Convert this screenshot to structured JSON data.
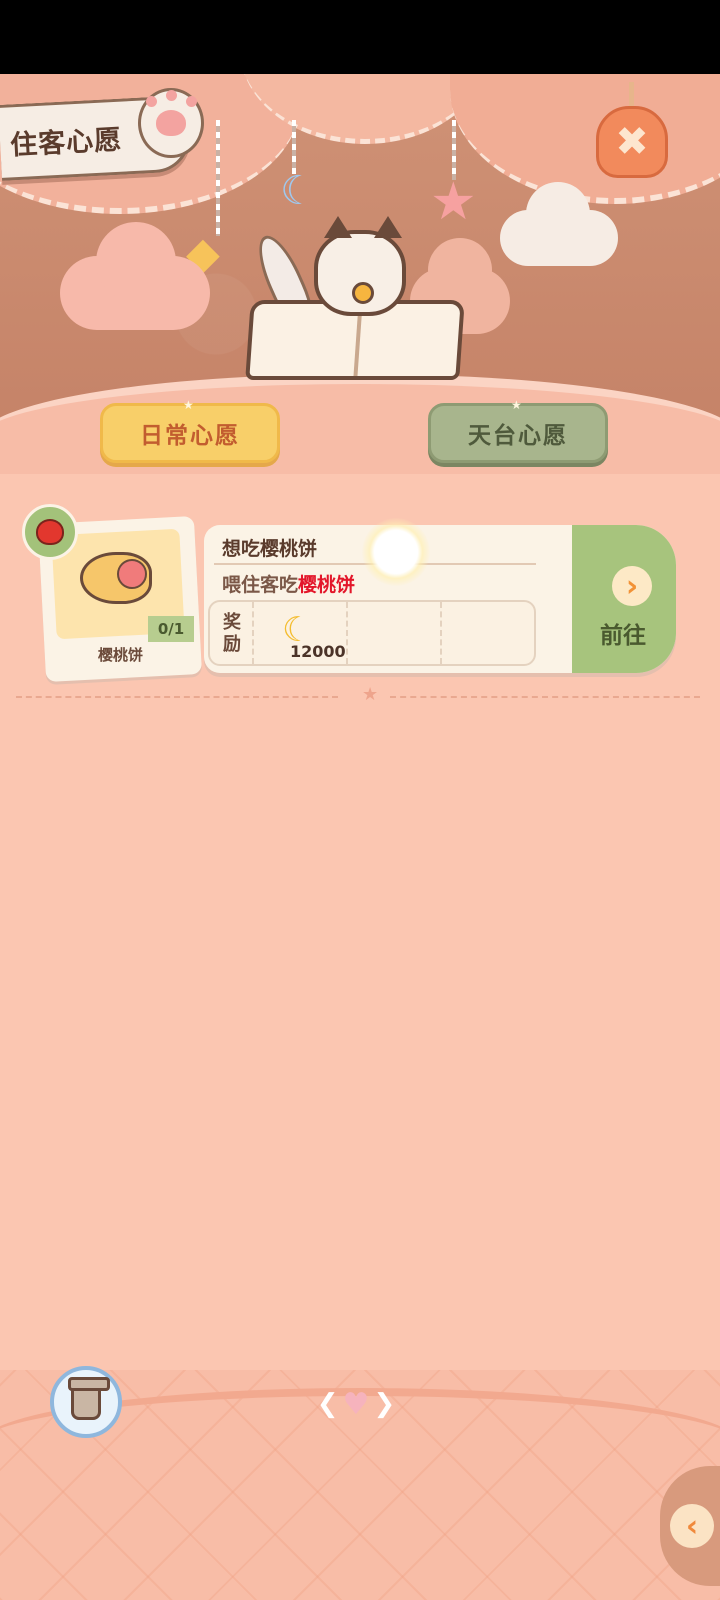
{
  "header": {
    "title": "住客心愿",
    "close_icon": "close-icon"
  },
  "tabs": [
    {
      "label": "日常心愿",
      "active": true,
      "color": "#f8cf69"
    },
    {
      "label": "天台心愿",
      "active": false,
      "color": "#a8b58d"
    }
  ],
  "wish": {
    "title": "想吃樱桃饼",
    "desc_prefix": "喂住客吃",
    "desc_highlight": "樱桃饼",
    "highlight_color": "#e3162a",
    "reward_label": "奖励",
    "reward_icon": "banana-icon",
    "reward_amount": "12000",
    "go_label": "前往",
    "item": {
      "name": "樱桃饼",
      "progress": "0/1",
      "icon": "cherry-pie-icon"
    },
    "requester_icon": "red-bird-avatar"
  },
  "bottom": {
    "trash_icon": "trash-icon",
    "back_icon": "back-arrow-icon"
  }
}
